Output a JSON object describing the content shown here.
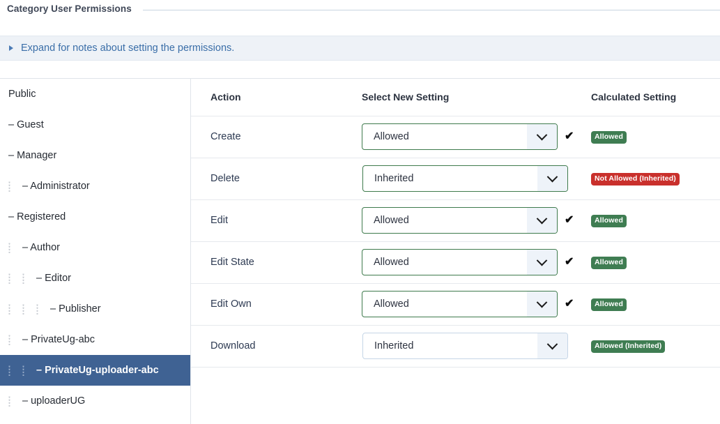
{
  "tab": {
    "label": "Category User Permissions"
  },
  "notes": {
    "caret_icon": "triangle-right-icon",
    "link_text": "Expand for notes about setting the permissions."
  },
  "sidebar": {
    "handle_icon": "drag-handle-dots-icon",
    "items": [
      {
        "label": "Public",
        "dashes": "",
        "handles": 0,
        "selected": false
      },
      {
        "label": "Guest",
        "dashes": "–",
        "handles": 0,
        "selected": false
      },
      {
        "label": "Manager",
        "dashes": "–",
        "handles": 0,
        "selected": false
      },
      {
        "label": "Administrator",
        "dashes": "–",
        "handles": 1,
        "selected": false
      },
      {
        "label": "Registered",
        "dashes": "–",
        "handles": 0,
        "selected": false
      },
      {
        "label": "Author",
        "dashes": "–",
        "handles": 1,
        "selected": false
      },
      {
        "label": "Editor",
        "dashes": "–",
        "handles": 2,
        "selected": false
      },
      {
        "label": "Publisher",
        "dashes": "–",
        "handles": 3,
        "selected": false
      },
      {
        "label": "PrivateUg-abc",
        "dashes": "–",
        "handles": 1,
        "selected": false
      },
      {
        "label": "PrivateUg-uploader-abc",
        "dashes": "–",
        "handles": 2,
        "selected": true
      },
      {
        "label": "uploaderUG",
        "dashes": "–",
        "handles": 1,
        "selected": false
      }
    ]
  },
  "table": {
    "headers": {
      "action": "Action",
      "select": "Select New Setting",
      "calculated": "Calculated Setting"
    },
    "rows": [
      {
        "action": "Create",
        "select_value": "Allowed",
        "select_state": "valid",
        "select_width": "allowed",
        "has_check": true,
        "check_icon": "checkmark-icon",
        "chevron_icon": "chevron-down-icon",
        "badge_text": "Allowed",
        "badge_color": "green"
      },
      {
        "action": "Delete",
        "select_value": "Inherited",
        "select_state": "valid",
        "select_width": "inherited",
        "has_check": false,
        "check_icon": "checkmark-icon",
        "chevron_icon": "chevron-down-icon",
        "badge_text": "Not Allowed (Inherited)",
        "badge_color": "red"
      },
      {
        "action": "Edit",
        "select_value": "Allowed",
        "select_state": "valid",
        "select_width": "allowed",
        "has_check": true,
        "check_icon": "checkmark-icon",
        "chevron_icon": "chevron-down-icon",
        "badge_text": "Allowed",
        "badge_color": "green"
      },
      {
        "action": "Edit State",
        "select_value": "Allowed",
        "select_state": "valid",
        "select_width": "allowed",
        "has_check": true,
        "check_icon": "checkmark-icon",
        "chevron_icon": "chevron-down-icon",
        "badge_text": "Allowed",
        "badge_color": "green"
      },
      {
        "action": "Edit Own",
        "select_value": "Allowed",
        "select_state": "valid",
        "select_width": "allowed",
        "has_check": true,
        "check_icon": "checkmark-icon",
        "chevron_icon": "chevron-down-icon",
        "badge_text": "Allowed",
        "badge_color": "green"
      },
      {
        "action": "Download",
        "select_value": "Inherited",
        "select_state": "plain",
        "select_width": "inherited",
        "has_check": false,
        "check_icon": "checkmark-icon",
        "chevron_icon": "chevron-down-icon",
        "badge_text": "Allowed (Inherited)",
        "badge_color": "green"
      }
    ]
  },
  "colors": {
    "selected_row": "#3f6293",
    "badge_green": "#3f7d52",
    "badge_red": "#c9302c",
    "select_valid_border": "#3e7a4c",
    "link_blue": "#3a6ea8",
    "notes_bg": "#eef2f7"
  }
}
